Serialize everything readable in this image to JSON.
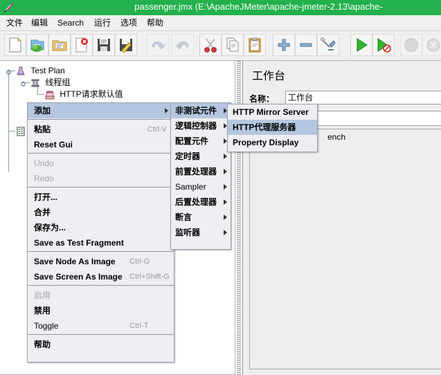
{
  "window": {
    "title": "passenger.jmx (E:\\ApacheJMeter\\apache-jmeter-2.13\\apache-",
    "title_bar_color": "#22b14c",
    "app_icon": "jmeter-feather-icon"
  },
  "menubar": {
    "items": [
      {
        "label": "文件",
        "name": "menu-file"
      },
      {
        "label": "编辑",
        "name": "menu-edit"
      },
      {
        "label": "Search",
        "name": "menu-search"
      },
      {
        "label": "运行",
        "name": "menu-run"
      },
      {
        "label": "选项",
        "name": "menu-options"
      },
      {
        "label": "帮助",
        "name": "menu-help"
      }
    ]
  },
  "toolbar": {
    "buttons": [
      {
        "name": "new-button",
        "icon": "new-document-icon",
        "disabled": false
      },
      {
        "name": "templates-button",
        "icon": "templates-icon",
        "disabled": false
      },
      {
        "name": "open-button",
        "icon": "open-folder-icon",
        "disabled": false
      },
      {
        "name": "close-button",
        "icon": "close-document-icon",
        "disabled": false
      },
      {
        "name": "save-button",
        "icon": "floppy-save-icon",
        "disabled": false
      },
      {
        "name": "save-as-button",
        "icon": "save-as-pencil-icon",
        "disabled": false
      },
      {
        "name": "undo-button",
        "icon": "undo-arrow-icon",
        "disabled": true
      },
      {
        "name": "redo-button",
        "icon": "redo-arrow-icon",
        "disabled": true
      },
      {
        "name": "cut-button",
        "icon": "scissors-icon",
        "disabled": false
      },
      {
        "name": "copy-button",
        "icon": "copy-pages-icon",
        "disabled": false
      },
      {
        "name": "paste-button",
        "icon": "clipboard-paste-icon",
        "disabled": false
      },
      {
        "name": "expand-all-button",
        "icon": "plus-icon",
        "disabled": false
      },
      {
        "name": "collapse-all-button",
        "icon": "minus-icon",
        "disabled": false
      },
      {
        "name": "toggle-button",
        "icon": "toggle-wrench-icon",
        "disabled": false
      },
      {
        "name": "start-button",
        "icon": "green-play-icon",
        "disabled": false
      },
      {
        "name": "start-no-pause-button",
        "icon": "green-play-no-timer-icon",
        "disabled": false
      },
      {
        "name": "stop-button",
        "icon": "stop-octagon-icon",
        "disabled": true
      },
      {
        "name": "shutdown-button",
        "icon": "shutdown-circle-icon",
        "disabled": true
      }
    ]
  },
  "tree": {
    "nodes": [
      {
        "label": "Test Plan",
        "icon": "test-plan-flask-icon",
        "depth": 0,
        "name": "tree-node-test-plan"
      },
      {
        "label": "线程组",
        "icon": "thread-group-icon",
        "depth": 1,
        "name": "tree-node-thread-group"
      },
      {
        "label": "HTTP请求默认值",
        "icon": "http-defaults-icon",
        "depth": 2,
        "name": "tree-node-http-defaults"
      },
      {
        "label": "",
        "icon": "workbench-icon",
        "depth": 0,
        "name": "tree-node-workbench"
      }
    ]
  },
  "context_menu": {
    "name": "tree-context-menu",
    "items": [
      {
        "label": "添加",
        "accel": "",
        "selected": true,
        "submenu": true,
        "disabled": false,
        "bold": true,
        "name": "context-menu-item-add"
      },
      {
        "separator": true
      },
      {
        "label": "粘贴",
        "accel": "Ctrl-V",
        "submenu": false,
        "disabled": false,
        "bold": true,
        "name": "context-menu-item-paste"
      },
      {
        "label": "Reset Gui",
        "accel": "",
        "submenu": false,
        "disabled": false,
        "bold": true,
        "name": "context-menu-item-reset-gui"
      },
      {
        "separator": true
      },
      {
        "label": "Undo",
        "accel": "",
        "submenu": false,
        "disabled": true,
        "bold": false,
        "name": "context-menu-item-undo"
      },
      {
        "label": "Redo",
        "accel": "",
        "submenu": false,
        "disabled": true,
        "bold": false,
        "name": "context-menu-item-redo"
      },
      {
        "separator": true
      },
      {
        "label": "打开...",
        "accel": "",
        "submenu": false,
        "disabled": false,
        "bold": true,
        "name": "context-menu-item-open"
      },
      {
        "label": "合并",
        "accel": "",
        "submenu": false,
        "disabled": false,
        "bold": true,
        "name": "context-menu-item-merge"
      },
      {
        "label": "保存为...",
        "accel": "",
        "submenu": false,
        "disabled": false,
        "bold": true,
        "name": "context-menu-item-save-as"
      },
      {
        "label": "Save as Test Fragment",
        "accel": "",
        "submenu": false,
        "disabled": false,
        "bold": true,
        "name": "context-menu-item-save-as-test-fragment"
      },
      {
        "separator": true
      },
      {
        "label": "Save Node As Image",
        "accel": "Ctrl-G",
        "submenu": false,
        "disabled": false,
        "bold": true,
        "name": "context-menu-item-save-node-as-image"
      },
      {
        "label": "Save Screen As Image",
        "accel": "Ctrl+Shift-G",
        "submenu": false,
        "disabled": false,
        "bold": true,
        "name": "context-menu-item-save-screen-as-image"
      },
      {
        "separator": true
      },
      {
        "label": "启用",
        "accel": "",
        "submenu": false,
        "disabled": true,
        "bold": false,
        "name": "context-menu-item-enable"
      },
      {
        "label": "禁用",
        "accel": "",
        "submenu": false,
        "disabled": false,
        "bold": true,
        "name": "context-menu-item-disable"
      },
      {
        "label": "Toggle",
        "accel": "Ctrl-T",
        "submenu": false,
        "disabled": false,
        "bold": false,
        "name": "context-menu-item-toggle"
      },
      {
        "separator": true
      },
      {
        "label": "帮助",
        "accel": "",
        "submenu": false,
        "disabled": false,
        "bold": true,
        "name": "context-menu-item-help"
      }
    ]
  },
  "add_submenu": {
    "name": "add-submenu",
    "items": [
      {
        "label": "非测试元件",
        "selected": true,
        "submenu": true,
        "bold": true,
        "name": "submenu-item-non-test-elements"
      },
      {
        "label": "逻辑控制器",
        "selected": false,
        "submenu": true,
        "bold": true,
        "name": "submenu-item-logic-controller"
      },
      {
        "label": "配置元件",
        "selected": false,
        "submenu": true,
        "bold": true,
        "name": "submenu-item-config-element"
      },
      {
        "label": "定时器",
        "selected": false,
        "submenu": true,
        "bold": true,
        "name": "submenu-item-timer"
      },
      {
        "label": "前置处理器",
        "selected": false,
        "submenu": true,
        "bold": true,
        "name": "submenu-item-pre-processor"
      },
      {
        "label": "Sampler",
        "selected": false,
        "submenu": true,
        "bold": false,
        "name": "submenu-item-sampler"
      },
      {
        "label": "后置处理器",
        "selected": false,
        "submenu": true,
        "bold": true,
        "name": "submenu-item-post-processor"
      },
      {
        "label": "断言",
        "selected": false,
        "submenu": true,
        "bold": true,
        "name": "submenu-item-assertions"
      },
      {
        "label": "监听器",
        "selected": false,
        "submenu": true,
        "bold": true,
        "name": "submenu-item-listener"
      }
    ]
  },
  "non_test_elements_submenu": {
    "name": "non-test-elements-submenu",
    "items": [
      {
        "label": "HTTP Mirror Server",
        "selected": false,
        "bold": true,
        "name": "submenu-item-http-mirror-server"
      },
      {
        "label": "HTTP代理服务器",
        "selected": true,
        "bold": true,
        "name": "submenu-item-http-proxy-server"
      },
      {
        "label": "Property Display",
        "selected": false,
        "bold": true,
        "name": "submenu-item-property-display"
      }
    ]
  },
  "right_panel": {
    "title": "工作台",
    "name_label": "名称：",
    "name_value": "工作台",
    "comment_value": "",
    "description_fragment": "ench"
  }
}
